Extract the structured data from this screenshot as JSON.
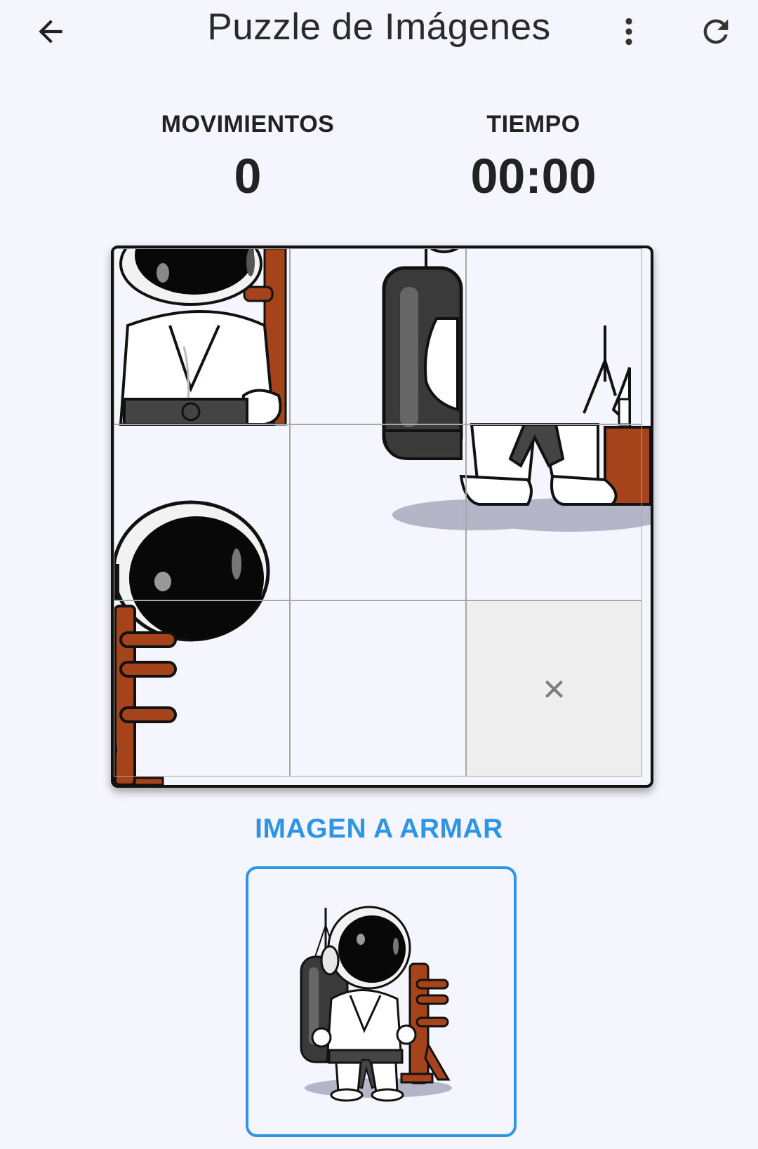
{
  "header": {
    "title": "Puzzle de Imágenes",
    "back_icon": "arrow-left-icon",
    "menu_icon": "more-vert-icon",
    "refresh_icon": "refresh-icon"
  },
  "stats": {
    "moves_label": "MOVIMIENTOS",
    "moves_value": "0",
    "time_label": "TIEMPO",
    "time_value": "00:00"
  },
  "puzzle": {
    "grid": "3x3",
    "empty_tile_icon": "close-icon",
    "empty_symbol": "×"
  },
  "target": {
    "title": "IMAGEN A ARMAR",
    "image": "astronaut-karate-illustration"
  },
  "colors": {
    "background": "#f5f5fd",
    "accent": "#2e95e6",
    "text": "#222222",
    "empty_tile": "#eeeeee",
    "wood": "#a5431b"
  }
}
